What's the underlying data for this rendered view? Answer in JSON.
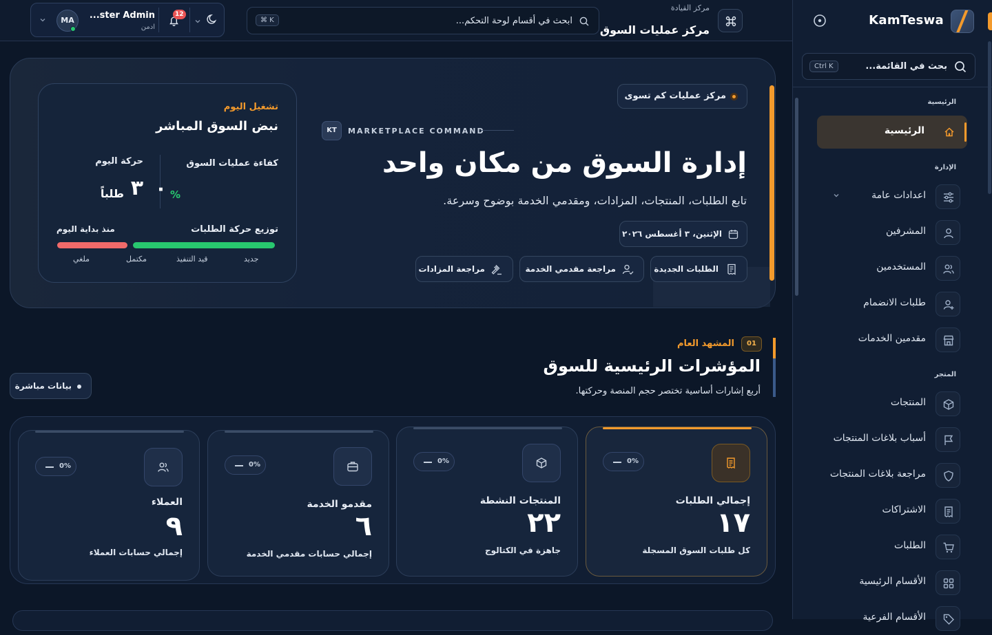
{
  "brand": {
    "name": "KamTeswa"
  },
  "sidebar": {
    "search": {
      "placeholder": "بحث في القائمة...",
      "shortcut": "Ctrl K"
    },
    "sections": {
      "main": "الرئيسية",
      "admin": "الإدارة",
      "store": "المتجر"
    },
    "items": [
      {
        "label": "الرئيسية",
        "icon": "home-icon",
        "active": true
      },
      {
        "label": "اعدادات عامة",
        "icon": "sliders-icon",
        "has_chevron": true
      },
      {
        "label": "المشرفين",
        "icon": "user-icon"
      },
      {
        "label": "المستخدمين",
        "icon": "users-icon"
      },
      {
        "label": "طلبات الانضمام",
        "icon": "user-plus-icon"
      },
      {
        "label": "مقدمين الخدمات",
        "icon": "store-icon"
      },
      {
        "label": "المنتجات",
        "icon": "box-icon"
      },
      {
        "label": "أسباب بلاغات المنتجات",
        "icon": "flag-icon"
      },
      {
        "label": "مراجعة بلاغات المنتجات",
        "icon": "shield-icon"
      },
      {
        "label": "الاشتراكات",
        "icon": "receipt-icon"
      },
      {
        "label": "الطلبات",
        "icon": "cart-icon"
      },
      {
        "label": "الأقسام الرئيسية",
        "icon": "grid-icon"
      },
      {
        "label": "الأقسام الفرعية",
        "icon": "tag-icon"
      }
    ]
  },
  "header": {
    "breadcrumb": "مركز القيادة",
    "title": "مركز عمليات السوق",
    "search": {
      "placeholder": "ابحث في أقسام لوحة التحكم...",
      "shortcut": "⌘ K"
    },
    "notifications": {
      "count": "12"
    },
    "user": {
      "name": "Master Admin",
      "name_display": "...ster Admin",
      "role": "ادمن",
      "initials": "MA"
    }
  },
  "hero": {
    "tag": "مركز عمليات كم تسوى",
    "kt": "KT",
    "kicker": "MARKETPLACE COMMAND",
    "headline": "إدارة السوق من مكان واحد",
    "subtitle": "تابع الطلبات، المنتجات، المزادات، ومقدمي الخدمة بوضوح وسرعة.",
    "date": "الإثنين، ٣ أغسطس ٢٠٢٦",
    "actions": [
      {
        "label": "الطلبات الجديدة",
        "icon": "receipt-icon"
      },
      {
        "label": "مراجعة مقدمي الخدمة",
        "icon": "user-check-icon"
      },
      {
        "label": "مراجعة المزادات",
        "icon": "gavel-icon"
      }
    ]
  },
  "pulse": {
    "kicker": "تشغيل اليوم",
    "title": "نبض السوق المباشر",
    "efficiency": {
      "label": "كفاءة عمليات السوق",
      "value": "٠",
      "unit": "%"
    },
    "traffic": {
      "label": "حركة اليوم",
      "value": "٣",
      "unit": "طلباً"
    },
    "distribution": {
      "label": "توزيع حركة الطلبات",
      "since": "منذ بداية اليوم"
    },
    "legend": [
      "جديد",
      "قيد التنفيذ",
      "مكتمل",
      "ملغي"
    ],
    "colors": {
      "new": "#28c76f",
      "cancelled": "#f06a6a"
    }
  },
  "overview": {
    "index": "01",
    "kicker": "المشهد العام",
    "title": "المؤشرات الرئيسية للسوق",
    "description": "أربع إشارات أساسية تختصر حجم المنصة وحركتها.",
    "live": "بيانات مباشرة"
  },
  "stats": [
    {
      "name": "إجمالي الطلبات",
      "value": "١٧",
      "desc": "كل طلبات السوق المسجلة",
      "change": "0%",
      "icon": "receipt-icon"
    },
    {
      "name": "المنتجات النشطة",
      "value": "٢٢",
      "desc": "جاهزة في الكتالوج",
      "change": "0%",
      "icon": "box-icon"
    },
    {
      "name": "مقدمو الخدمة",
      "value": "٦",
      "desc": "إجمالي حسابات مقدمي الخدمة",
      "change": "0%",
      "icon": "briefcase-icon"
    },
    {
      "name": "العملاء",
      "value": "٩",
      "desc": "إجمالي حسابات العملاء",
      "change": "0%",
      "icon": "users-icon"
    }
  ],
  "theme": {
    "accent": "#f39a2c",
    "background": "#0c1728",
    "panel": "#111e33"
  }
}
